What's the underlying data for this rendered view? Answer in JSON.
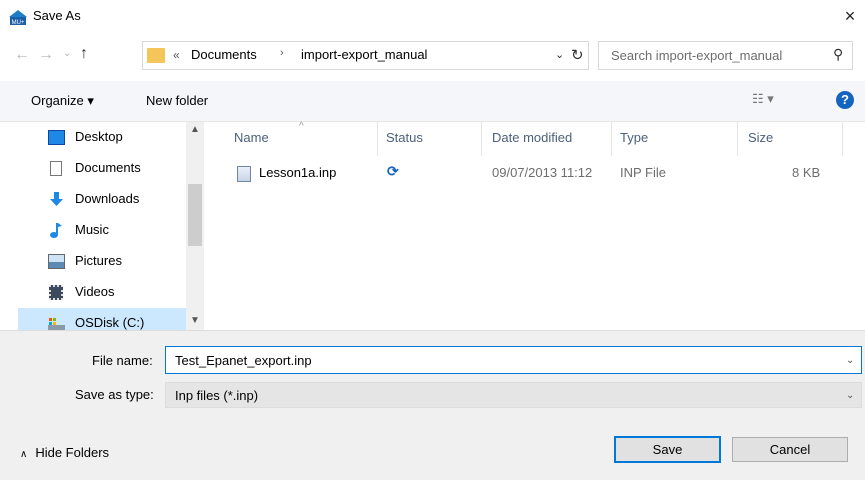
{
  "window": {
    "title": "Save As",
    "close_glyph": "×",
    "app_icon_text": "MU+"
  },
  "nav": {
    "back_glyph": "←",
    "forward_glyph": "→",
    "history_glyph": "⌄",
    "up_glyph": "↑",
    "breadcrumb": {
      "overflow": "«",
      "items": [
        "Documents",
        "import-export_manual"
      ],
      "separator": "›"
    },
    "dropdown_glyph": "⌄",
    "refresh_glyph": "↻",
    "search_placeholder": "Search import-export_manual",
    "search_glyph": "⚲"
  },
  "toolbar": {
    "organize_label": "Organize ▾",
    "new_folder_label": "New folder",
    "view_glyph": "☷ ▾",
    "help_glyph": "?"
  },
  "sidebar": {
    "items": [
      {
        "label": "Desktop",
        "icon": "desktop-icon"
      },
      {
        "label": "Documents",
        "icon": "documents-icon"
      },
      {
        "label": "Downloads",
        "icon": "downloads-icon"
      },
      {
        "label": "Music",
        "icon": "music-icon"
      },
      {
        "label": "Pictures",
        "icon": "pictures-icon"
      },
      {
        "label": "Videos",
        "icon": "videos-icon"
      },
      {
        "label": "OSDisk (C:)",
        "icon": "drive-icon",
        "selected": true
      }
    ],
    "scroll_up": "▲",
    "scroll_down": "▼"
  },
  "filelist": {
    "columns": [
      "Name",
      "Status",
      "Date modified",
      "Type",
      "Size"
    ],
    "sort_glyph": "^",
    "rows": [
      {
        "name": "Lesson1a.inp",
        "status_icon": "sync-icon",
        "status_glyph": "⟳",
        "date": "09/07/2013 11:12",
        "type": "INP File",
        "size": "8 KB"
      }
    ]
  },
  "form": {
    "filename_label": "File name:",
    "filename_value": "Test_Epanet_export.inp",
    "savetype_label": "Save as type:",
    "savetype_value": "Inp files (*.inp)",
    "dropdown_glyph": "⌄"
  },
  "footer": {
    "hide_folders_label": "Hide Folders",
    "hide_glyph": "∧",
    "save_label": "Save",
    "cancel_label": "Cancel"
  },
  "colors": {
    "accent": "#0078d7",
    "folder": "#f4c65a",
    "selected": "#cce8ff"
  }
}
